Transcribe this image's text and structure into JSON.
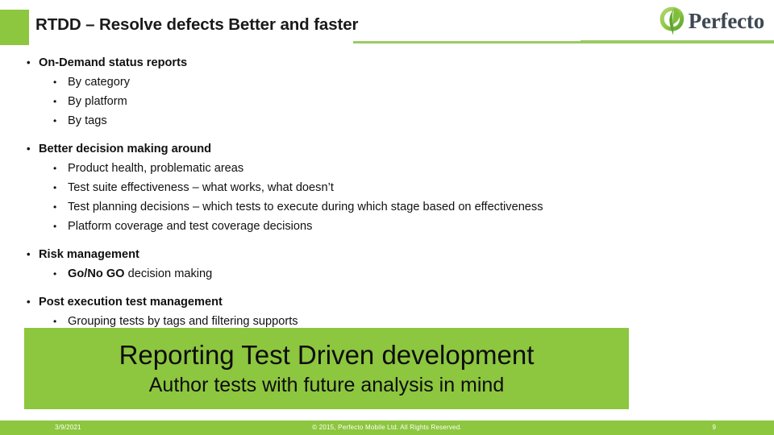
{
  "colors": {
    "brand_green": "#8DC63F",
    "rule_green": "#9ACB63",
    "text_dark": "#111111",
    "logo_word": "#3d4852"
  },
  "header": {
    "title": "RTDD – Resolve defects Better and faster",
    "logo_text": "Perfecto",
    "logo_icon": "perfecto-leaf-logo-icon"
  },
  "body": {
    "groups": [
      {
        "heading": "On-Demand status reports",
        "items": [
          {
            "text": "By category"
          },
          {
            "text": "By platform"
          },
          {
            "text": "By tags"
          }
        ]
      },
      {
        "heading": "Better decision making around",
        "items": [
          {
            "text": "Product health, problematic areas"
          },
          {
            "text": "Test suite effectiveness – what works, what doesn’t"
          },
          {
            "text": "Test planning decisions – which tests to execute during which stage based on effectiveness"
          },
          {
            "text": "Platform coverage and test coverage decisions"
          }
        ]
      },
      {
        "heading": "Risk management",
        "items": [
          {
            "lead": "Go/No GO",
            "text": " decision making"
          }
        ]
      },
      {
        "heading": "Post execution test management",
        "items": [
          {
            "text": "Grouping tests by tags and filtering supports"
          }
        ]
      }
    ]
  },
  "callout": {
    "line1": "Reporting Test Driven development",
    "line2": "Author tests with future analysis in mind"
  },
  "footer": {
    "date": "3/9/2021",
    "copyright": "© 2015, Perfecto Mobile Ltd. All Rights Reserved.",
    "page_number": "9"
  }
}
